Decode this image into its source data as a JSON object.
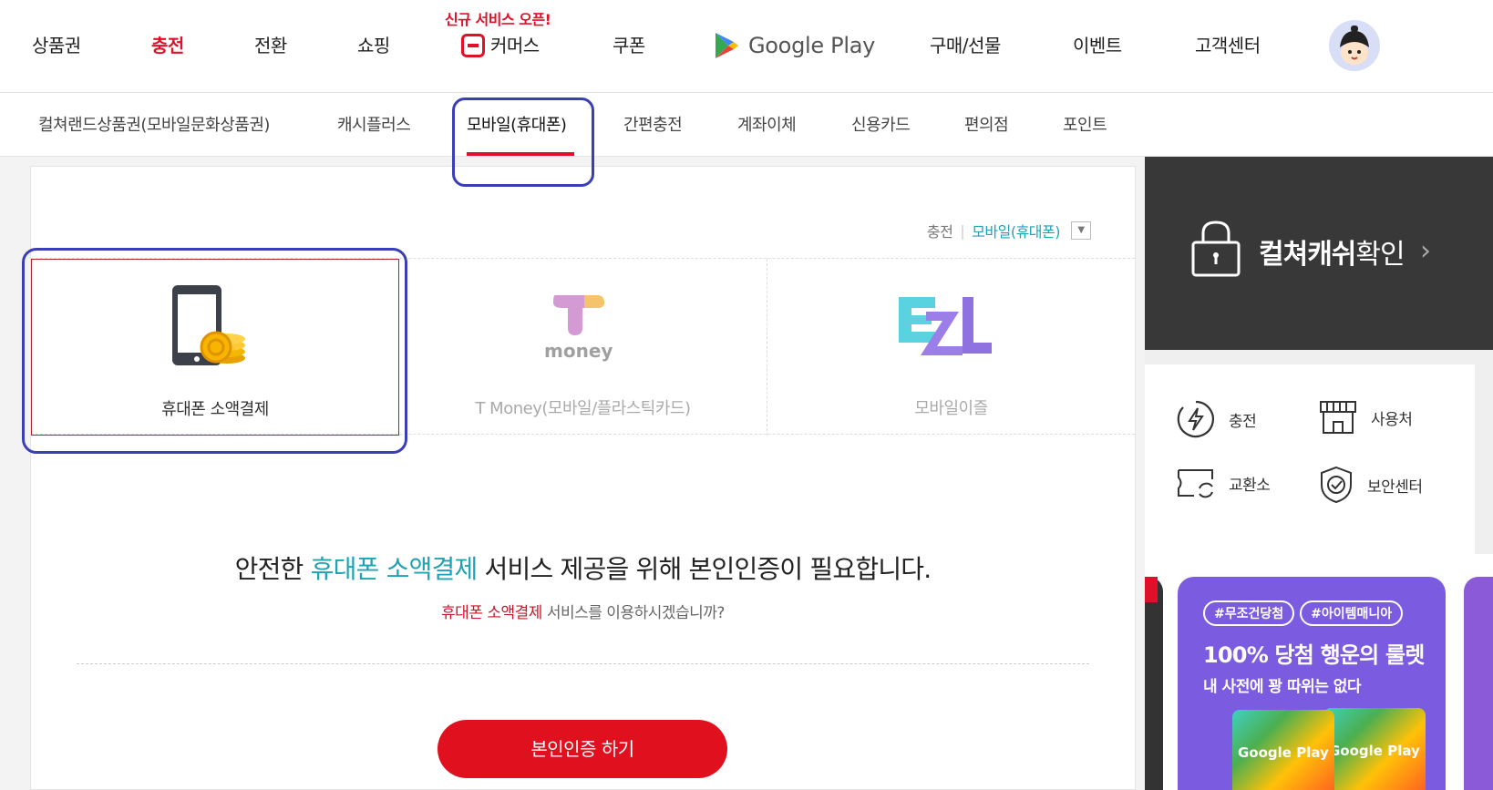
{
  "topnav": {
    "items": [
      "상품권",
      "충전",
      "전환",
      "쇼핑",
      "커머스",
      "쿠폰",
      "구매/선물",
      "이벤트",
      "고객센터"
    ],
    "promo_label": "신규 서비스 오픈!",
    "google_play": "Google Play"
  },
  "subnav": {
    "items": [
      "컬쳐랜드상품권(모바일문화상품권)",
      "캐시플러스",
      "모바일(휴대폰)",
      "간편충전",
      "계좌이체",
      "신용카드",
      "편의점",
      "포인트"
    ]
  },
  "breadcrumb": {
    "parent": "충전",
    "current": "모바일(휴대폰)"
  },
  "cards": [
    {
      "label": "휴대폰 소액결제"
    },
    {
      "label": "T Money(모바일/플라스틱카드)",
      "logo_text": "money"
    },
    {
      "label": "모바일이즐"
    }
  ],
  "message": {
    "prefix": "안전한 ",
    "highlight": "휴대폰 소액결제",
    "suffix": " 서비스 제공을 위해 본인인증이 필요합니다.",
    "sub_highlight": "휴대폰 소액결제",
    "sub_suffix": " 서비스를 이용하시겠습니까?"
  },
  "verify_button": "본인인증 하기",
  "sidebar": {
    "cash_bold": "컬쳐캐쉬",
    "cash_rest": "확인",
    "menu": [
      "충전",
      "사용처",
      "교환소",
      "보안센터"
    ],
    "banner": {
      "tags": [
        "#무조건당첨",
        "#아이템매니아"
      ],
      "title": "100% 당첨 행운의 룰렛",
      "subtitle": "내 사전에 꽝 따위는 없다",
      "card_text": "Google Play"
    }
  },
  "colors": {
    "accent_red": "#e0102a",
    "teal": "#1fa3b4",
    "highlight_box": "#3a3fb5"
  }
}
